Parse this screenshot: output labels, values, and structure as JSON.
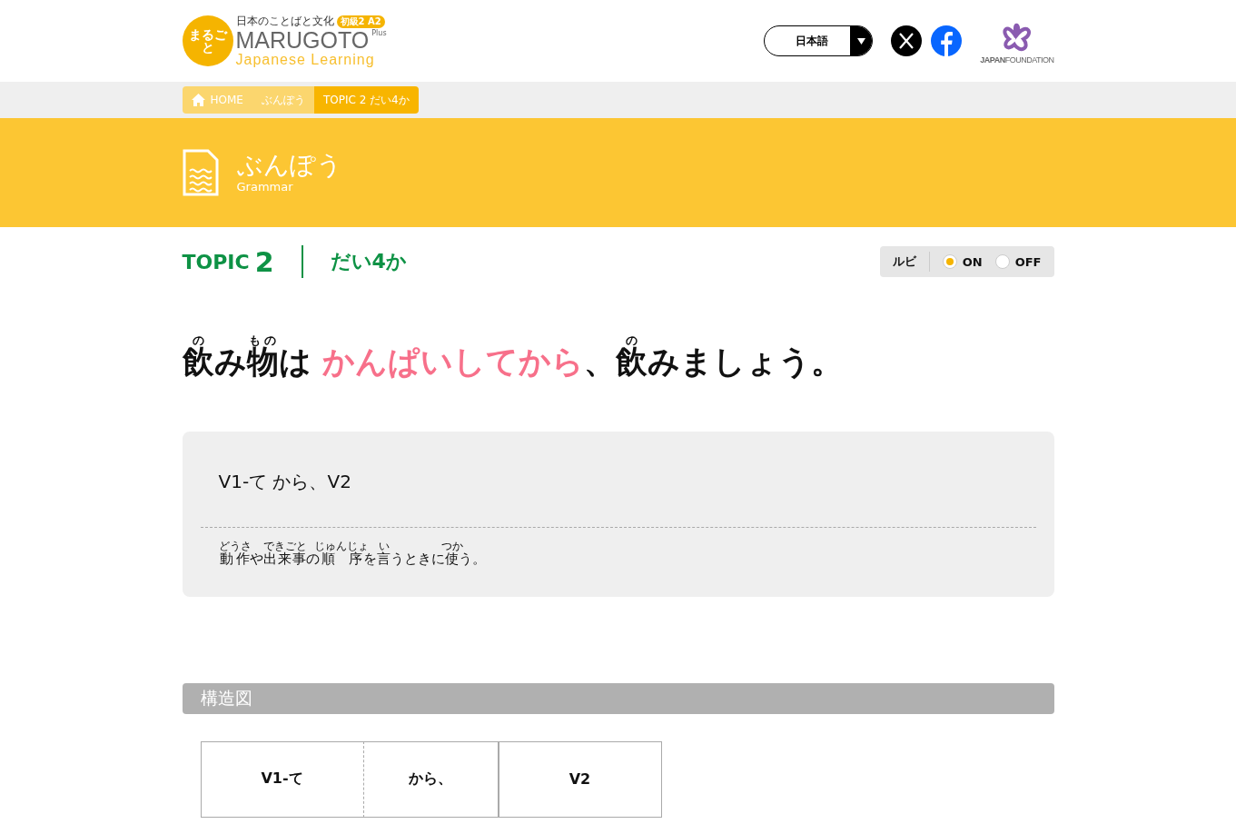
{
  "header": {
    "logo": {
      "mark": "まるごと",
      "tagline": "日本のことばと文化",
      "level": "初級2 A2",
      "name": "MARUGOTO",
      "plus": "Plus",
      "subtitle": "Japanese Learning"
    },
    "language": "日本語",
    "partner": "**JAPAN**FOUNDATION"
  },
  "breadcrumb": [
    {
      "label": "HOME",
      "kind": "home"
    },
    {
      "label": "ぶんぽう",
      "kind": "link"
    },
    {
      "label": "TOPIC 2 だい4か",
      "kind": "current"
    }
  ],
  "banner": {
    "title": "ぶんぽう",
    "subtitle": "Grammar"
  },
  "topic": {
    "label": "TOPIC",
    "number": "2",
    "lesson": "だい4か"
  },
  "ruby_toggle": {
    "label": "ルビ",
    "options": [
      {
        "label": "ON",
        "selected": true
      },
      {
        "label": "OFF",
        "selected": false
      }
    ]
  },
  "example": [
    {
      "text": "飲",
      "ruby": "の",
      "highlight": false
    },
    {
      "text": "み",
      "highlight": false
    },
    {
      "text": "物",
      "ruby": "もの",
      "highlight": false
    },
    {
      "text": "は ",
      "highlight": false
    },
    {
      "text": "かんぱいしてから",
      "highlight": true
    },
    {
      "text": "、",
      "highlight": false
    },
    {
      "text": "飲",
      "ruby": "の",
      "highlight": false
    },
    {
      "text": "みましょう。",
      "highlight": false
    }
  ],
  "pattern": {
    "formula": "V1-て から、V2",
    "description": [
      {
        "text": "動作",
        "ruby": "どうさ"
      },
      {
        "text": "や"
      },
      {
        "text": "出来事",
        "ruby": "できごと"
      },
      {
        "text": "の"
      },
      {
        "text": "順序",
        "ruby": "じゅんじょ"
      },
      {
        "text": "を"
      },
      {
        "text": "言",
        "ruby": "い"
      },
      {
        "text": "うときに"
      },
      {
        "text": "使",
        "ruby": "つか"
      },
      {
        "text": "う。"
      }
    ]
  },
  "structure": {
    "title": "構造図",
    "cells": [
      "V1-て",
      "から、",
      "V2"
    ]
  }
}
